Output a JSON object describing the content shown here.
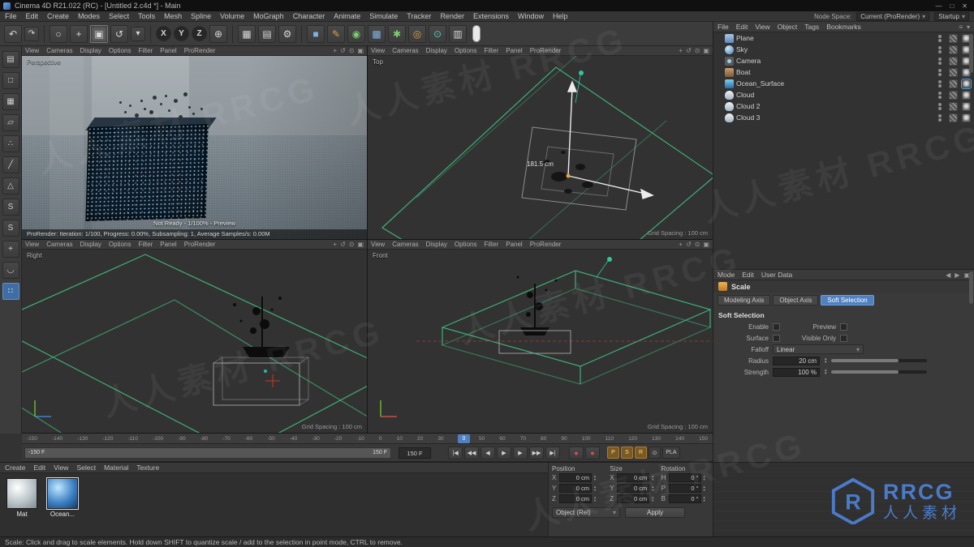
{
  "window": {
    "title": "Cinema 4D R21.022 (RC) - [Untitled 2.c4d *] - Main",
    "minimize": "—",
    "maximize": "□",
    "close": "✕"
  },
  "menubar": {
    "items": [
      "File",
      "Edit",
      "Create",
      "Modes",
      "Select",
      "Tools",
      "Mesh",
      "Spline",
      "Volume",
      "MoGraph",
      "Character",
      "Animate",
      "Simulate",
      "Tracker",
      "Render",
      "Extensions",
      "Window",
      "Help"
    ],
    "node_space_label": "Node Space:",
    "node_space_value": "Current (ProRender)",
    "layout_value": "Startup"
  },
  "toolbar": {
    "undo": "↶",
    "redo": "↷",
    "live_selection": "○",
    "move": "+",
    "scale": "▣",
    "rotate": "↺",
    "last_tool": "▾",
    "x": "X",
    "y": "Y",
    "z": "Z",
    "coord": "⊕",
    "render_view": "▦",
    "render_pv": "▤",
    "render_settings": "⚙",
    "cube": "■",
    "pen": "✎",
    "subdiv": "◉",
    "volume": "▩",
    "mograph": "✱",
    "dynamics": "◎",
    "tracker": "⊙",
    "display": "▥"
  },
  "left_tools": {
    "make_editable": "▤",
    "model": "□",
    "texture": "▦",
    "workplane": "▱",
    "points": "∴",
    "edges": "╱",
    "polygons": "△",
    "solo1": "S",
    "solo2": "S",
    "axis": "+",
    "magnet": "◡",
    "snap": "∷"
  },
  "viewports": {
    "menu": [
      "View",
      "Cameras",
      "Display",
      "Options",
      "Filter",
      "Panel",
      "ProRender"
    ],
    "corner_icons": [
      "+",
      "↺",
      "⊙",
      "▣"
    ],
    "perspective": {
      "label": "Perspective",
      "not_ready": "Not Ready - 1/100% - Preview",
      "status": "ProRender: Iteration: 1/100, Progress: 0.00%, Subsampling: 1, Average Samples/s: 0.00M"
    },
    "top": {
      "label": "Top",
      "grid": "Grid Spacing : 100 cm",
      "dim": "181.5 cm"
    },
    "right": {
      "label": "Right",
      "grid": "Grid Spacing : 100 cm"
    },
    "front": {
      "label": "Front",
      "grid": "Grid Spacing : 100 cm"
    }
  },
  "object_manager": {
    "menu": [
      "File",
      "Edit",
      "View",
      "Object",
      "Tags",
      "Bookmarks"
    ],
    "objects": [
      {
        "name": "Plane",
        "cls": "obj-plane"
      },
      {
        "name": "Sky",
        "cls": "obj-sky"
      },
      {
        "name": "Camera",
        "cls": "obj-camera"
      },
      {
        "name": "Boat",
        "cls": "obj-boat"
      },
      {
        "name": "Ocean_Surface",
        "cls": "obj-ocean"
      },
      {
        "name": "Cloud",
        "cls": "obj-cloud"
      },
      {
        "name": "Cloud 2",
        "cls": "obj-cloud"
      },
      {
        "name": "Cloud 3",
        "cls": "obj-cloud"
      }
    ]
  },
  "attributes": {
    "menu": [
      "Mode",
      "Edit",
      "User Data"
    ],
    "title": "Scale",
    "tabs": [
      {
        "label": "Modeling Axis"
      },
      {
        "label": "Object Axis"
      },
      {
        "label": "Soft Selection",
        "cls": "active"
      }
    ],
    "section": "Soft Selection",
    "enable_label": "Enable",
    "preview_label": "Preview",
    "surface_label": "Surface",
    "visible_label": "Visible Only",
    "falloff_label": "Falloff",
    "falloff_value": "Linear",
    "radius_label": "Radius",
    "radius_value": "20 cm",
    "strength_label": "Strength",
    "strength_value": "100 %"
  },
  "timeline": {
    "ticks": [
      "-150",
      "-140",
      "-130",
      "-120",
      "-110",
      "-100",
      "-90",
      "-80",
      "-70",
      "-60",
      "-50",
      "-40",
      "-30",
      "-20",
      "-10",
      "0",
      "10",
      "20",
      "30",
      "40",
      "50",
      "60",
      "70",
      "80",
      "90",
      "100",
      "110",
      "120",
      "130",
      "140",
      "150"
    ],
    "current": "0",
    "range_start": "-150 F",
    "range_end": "150 F",
    "end_field": "150 F"
  },
  "transport": {
    "goto_start": "|◀",
    "prev_key": "◀◀",
    "prev_frame": "◀",
    "play": "▶",
    "next_frame": "▶",
    "next_key": "▶▶",
    "goto_end": "▶|",
    "record": "●",
    "autokey": "●",
    "k_pos": "P",
    "k_scale": "S",
    "k_rot": "R",
    "k_param": "⊙",
    "k_pla": "PLA"
  },
  "materials": {
    "menu": [
      "Create",
      "Edit",
      "View",
      "Select",
      "Material",
      "Texture"
    ],
    "items": [
      {
        "name": "Mat",
        "cls": "mat-grey"
      },
      {
        "name": "Ocean...",
        "cls": "mat-ocean"
      }
    ]
  },
  "coordinates": {
    "headers": [
      "Position",
      "Size",
      "Rotation"
    ],
    "position": [
      {
        "axis": "X",
        "value": "0 cm"
      },
      {
        "axis": "Y",
        "value": "0 cm"
      },
      {
        "axis": "Z",
        "value": "0 cm"
      }
    ],
    "size": [
      {
        "axis": "X",
        "value": "0 cm"
      },
      {
        "axis": "Y",
        "value": "0 cm"
      },
      {
        "axis": "Z",
        "value": "0 cm"
      }
    ],
    "rotation": [
      {
        "axis": "H",
        "value": "0 °"
      },
      {
        "axis": "P",
        "value": "0 °"
      },
      {
        "axis": "B",
        "value": "0 °"
      }
    ],
    "mode": "Object (Rel)",
    "apply": "Apply"
  },
  "status_bar": {
    "text": "Scale: Click and drag to scale elements. Hold down SHIFT to quantize scale / add to the selection in point mode, CTRL to remove."
  },
  "watermark": {
    "text": "人人素材 RRCG",
    "logo_letter": "R",
    "logo_main": "RRCG",
    "logo_sub": "人人素材"
  }
}
